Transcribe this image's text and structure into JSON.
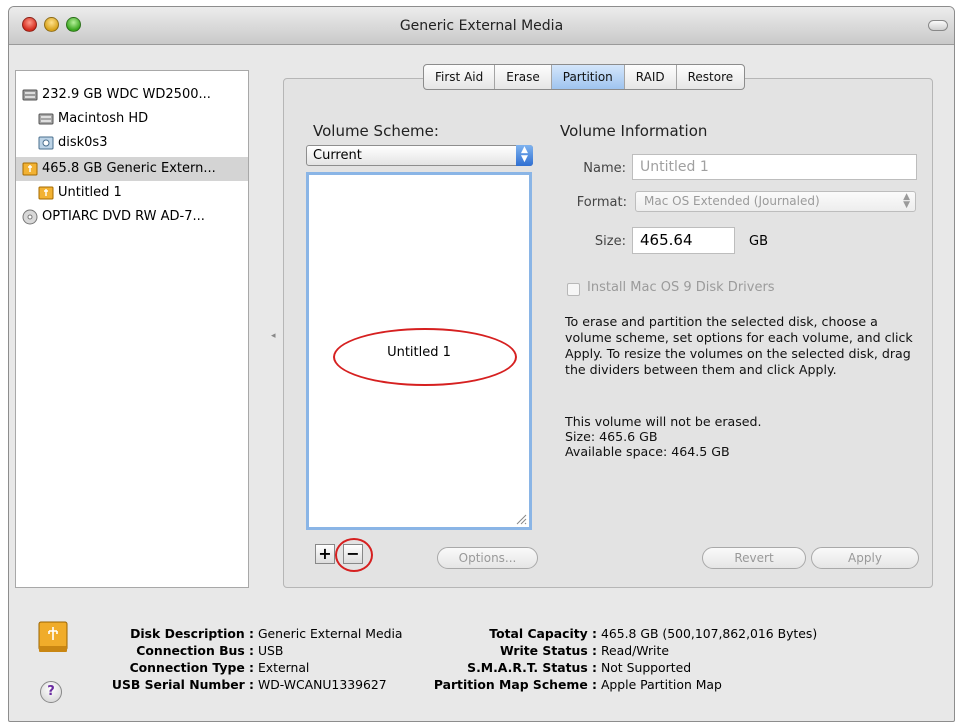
{
  "window": {
    "title": "Generic External Media"
  },
  "sidebar": {
    "items": [
      {
        "label": "232.9 GB WDC WD2500...",
        "icon": "internal-disk-icon"
      },
      {
        "label": "Macintosh HD",
        "icon": "volume-icon"
      },
      {
        "label": "disk0s3",
        "icon": "volume-icon"
      },
      {
        "label": "465.8 GB Generic Extern...",
        "icon": "external-disk-icon",
        "selected": true
      },
      {
        "label": "Untitled 1",
        "icon": "external-volume-icon"
      },
      {
        "label": "OPTIARC DVD RW AD-7...",
        "icon": "optical-drive-icon"
      }
    ]
  },
  "tabs": [
    "First Aid",
    "Erase",
    "Partition",
    "RAID",
    "Restore"
  ],
  "active_tab": "Partition",
  "partition": {
    "volume_scheme_label": "Volume Scheme:",
    "scheme_value": "Current",
    "partition_name": "Untitled 1",
    "add_label": "+",
    "remove_label": "−",
    "options_label": "Options...",
    "volume_info_label": "Volume Information",
    "name_label": "Name:",
    "name_value": "Untitled 1",
    "format_label": "Format:",
    "format_value": "Mac OS Extended (Journaled)",
    "size_label": "Size:",
    "size_value": "465.64",
    "size_unit": "GB",
    "install_drivers_label": "Install Mac OS 9 Disk Drivers",
    "description": "To erase and partition the selected disk, choose a volume scheme, set options for each volume, and click Apply. To resize the volumes on the selected disk, drag the dividers between them and click Apply.",
    "stat_erase": "This volume will not be erased.",
    "stat_size": "Size: 465.6 GB",
    "stat_available": "Available space: 464.5 GB",
    "revert_label": "Revert",
    "apply_label": "Apply"
  },
  "disk_info": {
    "left": [
      {
        "key": "Disk Description :",
        "value": "Generic External Media"
      },
      {
        "key": "Connection Bus :",
        "value": "USB"
      },
      {
        "key": "Connection Type :",
        "value": "External"
      },
      {
        "key": "USB Serial Number :",
        "value": "WD-WCANU1339627"
      }
    ],
    "right": [
      {
        "key": "Total Capacity :",
        "value": "465.8 GB (500,107,862,016 Bytes)"
      },
      {
        "key": "Write Status :",
        "value": "Read/Write"
      },
      {
        "key": "S.M.A.R.T. Status :",
        "value": "Not Supported"
      },
      {
        "key": "Partition Map Scheme :",
        "value": "Apple Partition Map"
      }
    ]
  },
  "help_label": "?",
  "colors": {
    "accent": "#3b7bd6",
    "annotation_red": "#d62020",
    "selection": "#d4d4d4"
  }
}
